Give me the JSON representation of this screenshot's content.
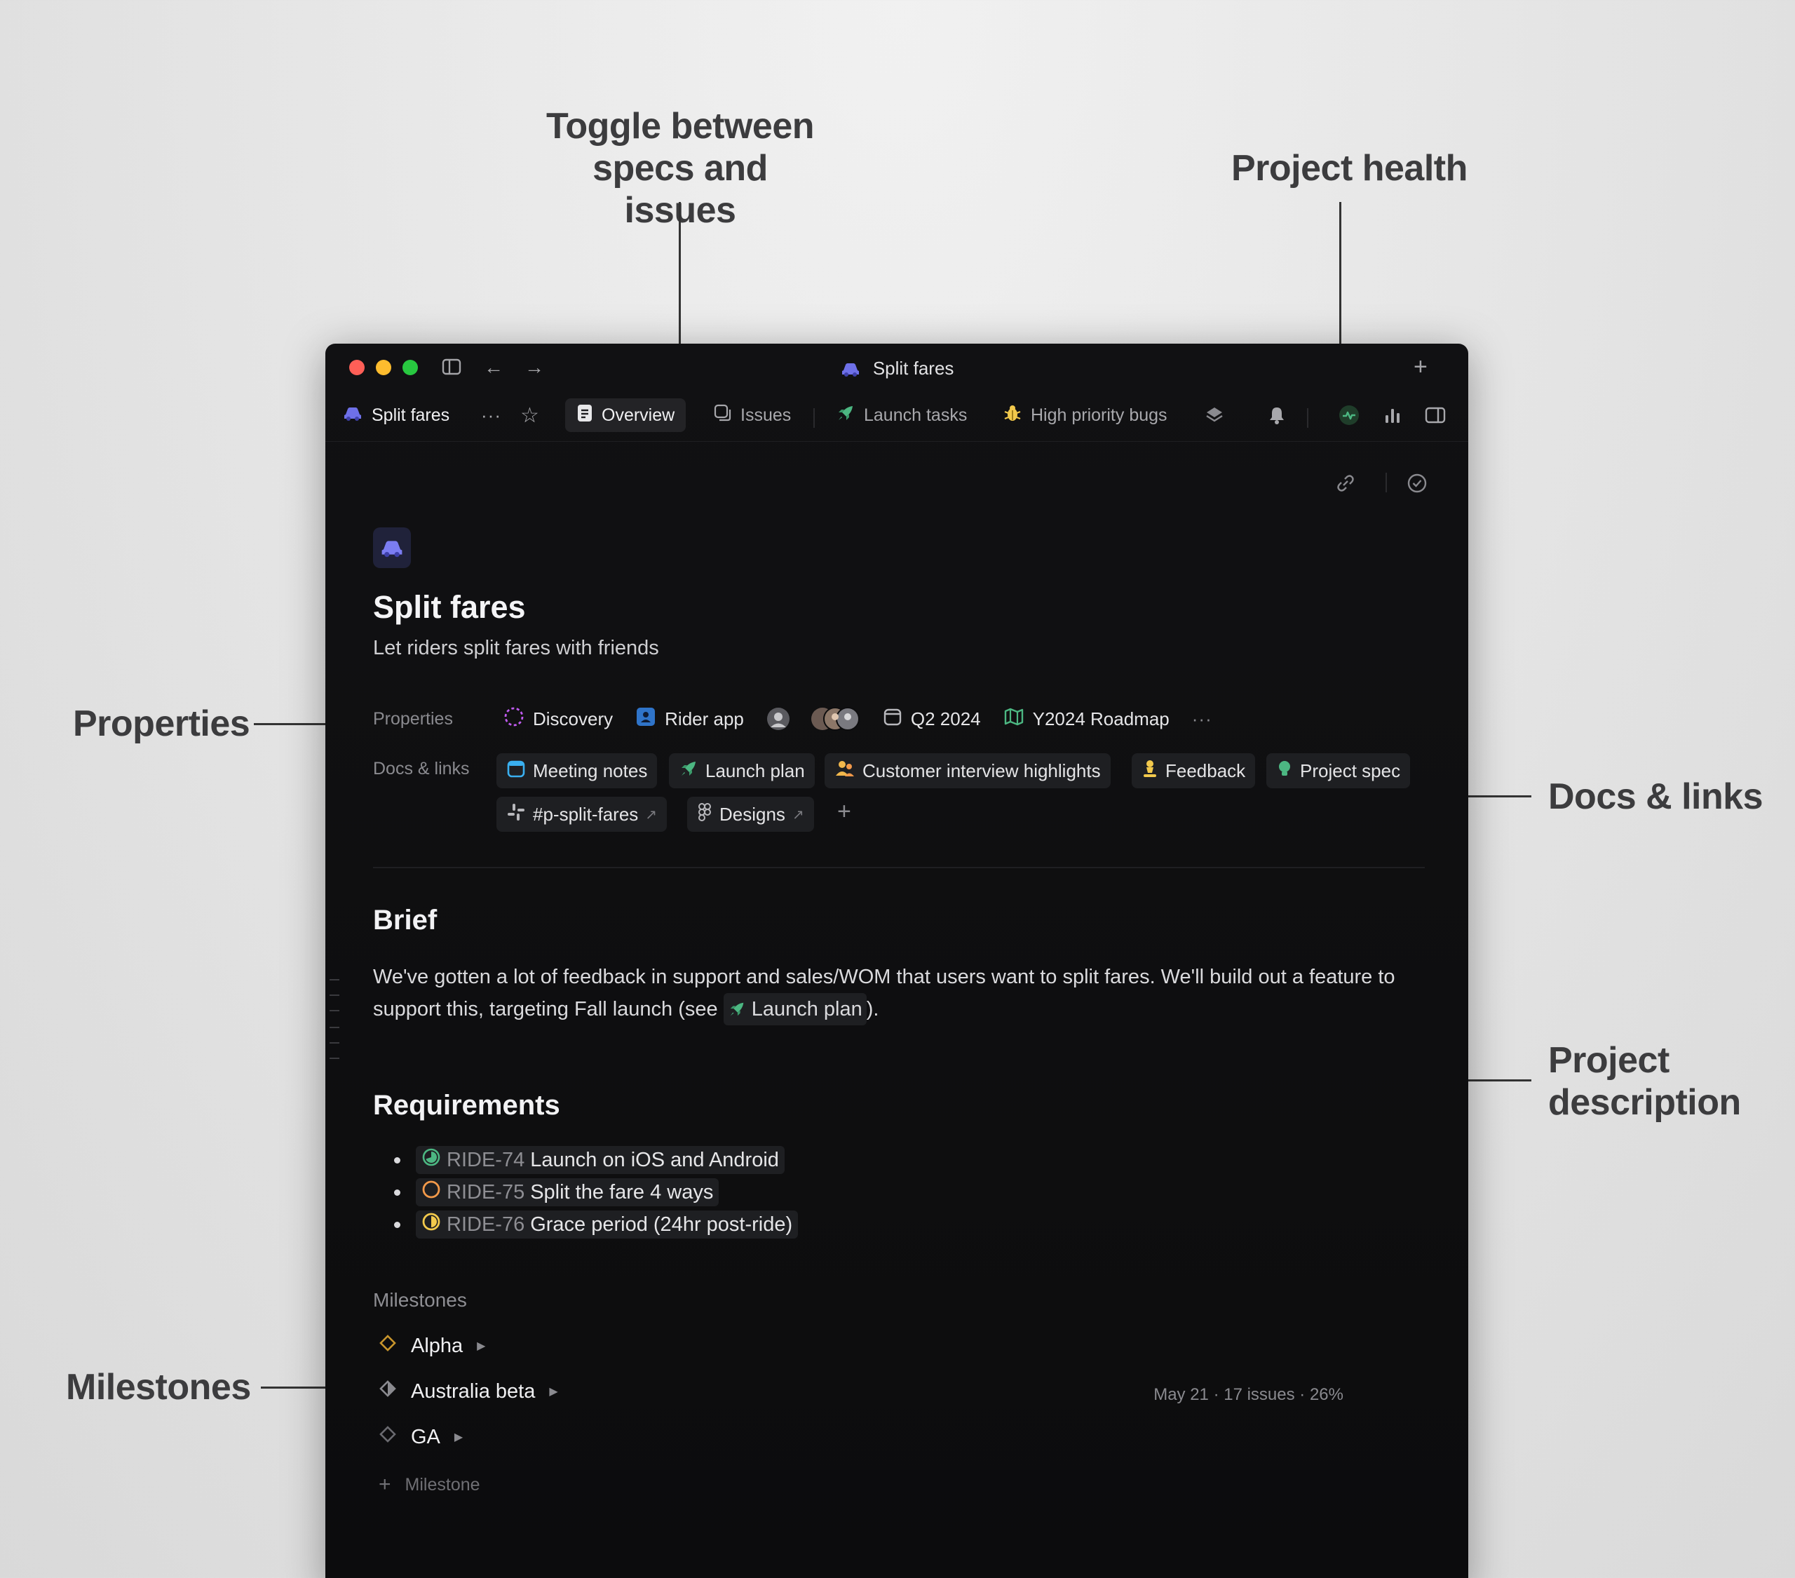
{
  "annotations": {
    "toggle": "Toggle between specs and issues",
    "health": "Project health",
    "properties": "Properties",
    "docs": "Docs & links",
    "description": "Project description",
    "milestones": "Milestones"
  },
  "window": {
    "title": "Split fares"
  },
  "tabbar": {
    "project_name": "Split fares",
    "more": "···",
    "tabs": [
      {
        "label": "Overview",
        "active": true
      },
      {
        "label": "Issues",
        "active": false
      },
      {
        "label": "Launch tasks",
        "active": false
      },
      {
        "label": "High priority bugs",
        "active": false
      }
    ]
  },
  "project": {
    "title": "Split fares",
    "summary": "Let riders split fares with friends",
    "properties_label": "Properties",
    "status": "Discovery",
    "team": "Rider app",
    "target": "Q2 2024",
    "roadmap": "Y2024 Roadmap",
    "docs_label": "Docs & links",
    "docs": [
      {
        "label": "Meeting notes",
        "icon": "calendar-icon"
      },
      {
        "label": "Launch plan",
        "icon": "rocket-icon"
      },
      {
        "label": "Customer interview highlights",
        "icon": "people-icon"
      },
      {
        "label": "Feedback",
        "icon": "person-icon"
      },
      {
        "label": "Project spec",
        "icon": "bulb-icon"
      }
    ],
    "links": [
      {
        "label": "#p-split-fares",
        "icon": "slack-icon"
      },
      {
        "label": "Designs",
        "icon": "figma-icon"
      }
    ]
  },
  "brief": {
    "heading": "Brief",
    "text_before": "We've gotten a lot of feedback in support and sales/WOM that users want to split fares. We'll build out a feature to support this, targeting Fall launch (see ",
    "chip": "Launch plan",
    "text_after": ")."
  },
  "requirements": {
    "heading": "Requirements",
    "items": [
      {
        "id": "RIDE-74",
        "title": "Launch on iOS and Android",
        "color": "#4cb782"
      },
      {
        "id": "RIDE-75",
        "title": "Split the fare 4 ways",
        "color": "#f2994a"
      },
      {
        "id": "RIDE-76",
        "title": "Grace period (24hr post-ride)",
        "color": "#f2c94c"
      }
    ]
  },
  "milestones": {
    "heading": "Milestones",
    "items": [
      {
        "name": "Alpha"
      },
      {
        "name": "Australia beta"
      },
      {
        "name": "GA"
      }
    ],
    "meta": "May 21 · 17 issues · 26%",
    "add_label": "Milestone"
  }
}
